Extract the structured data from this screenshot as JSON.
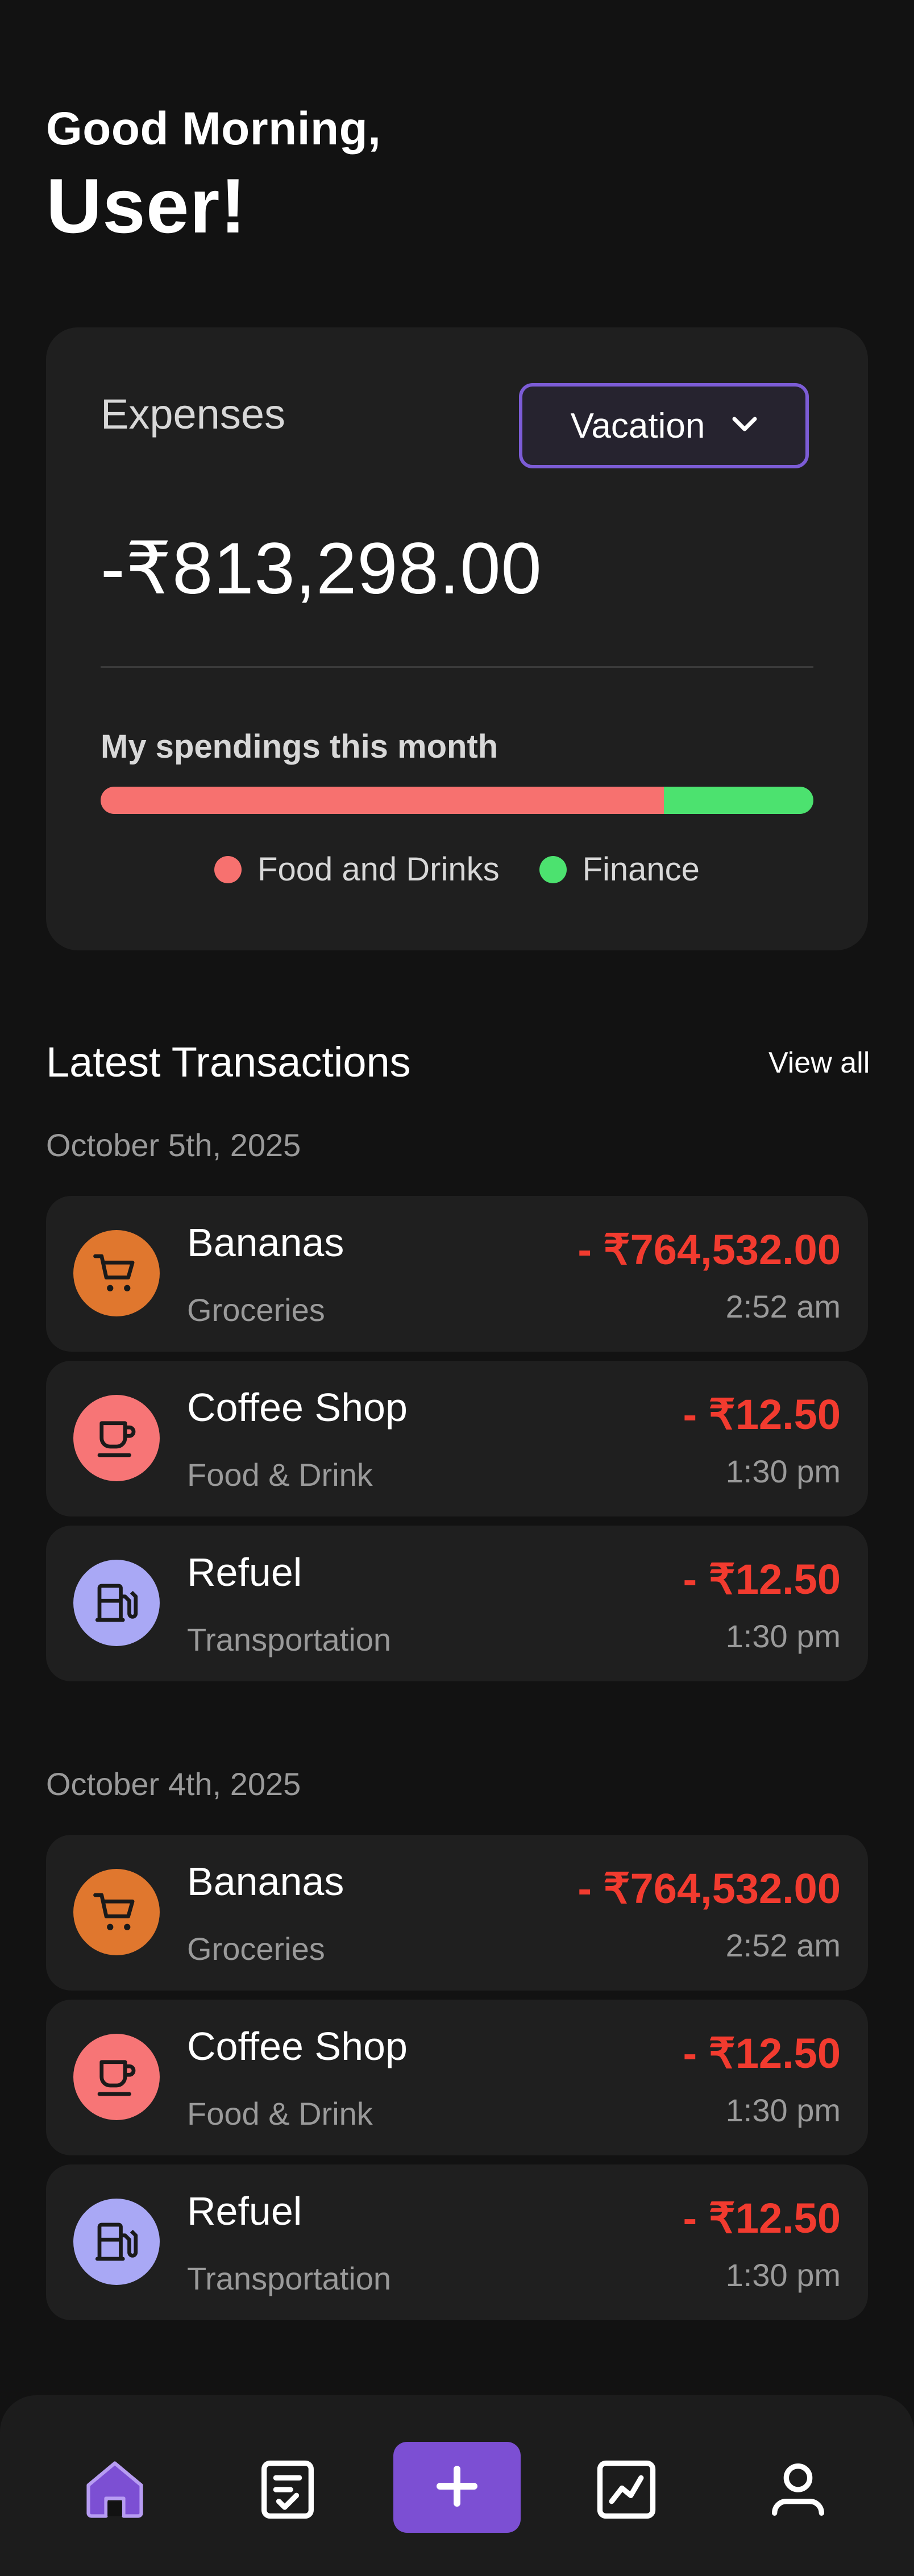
{
  "greeting": {
    "line1": "Good Morning,",
    "line2": "User!"
  },
  "expenses_card": {
    "label": "Expenses",
    "dropdown": {
      "selected": "Vacation",
      "icon": "chevron-down-icon"
    },
    "amount": "-₹813,298.00",
    "spendings_title": "My spendings this month",
    "spending_split": [
      {
        "category": "Food and Drinks",
        "fraction": 0.79,
        "color": "#f7716f"
      },
      {
        "category": "Finance",
        "fraction": 0.21,
        "color": "#4ce26f"
      }
    ],
    "legend": [
      {
        "label": "Food and Drinks",
        "color": "#f7716f"
      },
      {
        "label": "Finance",
        "color": "#4ce26f"
      }
    ]
  },
  "transactions": {
    "title": "Latest Transactions",
    "view_all": "View all",
    "groups": [
      {
        "date": "October 5th, 2025",
        "items": [
          {
            "name": "Bananas",
            "category": "Groceries",
            "amount": "- ₹764,532.00",
            "time": "2:52 am",
            "icon": "cart-icon",
            "icon_bg": "#e0772e"
          },
          {
            "name": "Coffee Shop",
            "category": "Food & Drink",
            "amount": "- ₹12.50",
            "time": "1:30 pm",
            "icon": "cup-icon",
            "icon_bg": "#f77576"
          },
          {
            "name": "Refuel",
            "category": "Transportation",
            "amount": "- ₹12.50",
            "time": "1:30 pm",
            "icon": "fuel-icon",
            "icon_bg": "#a9a8f5"
          }
        ]
      },
      {
        "date": "October 4th, 2025",
        "items": [
          {
            "name": "Bananas",
            "category": "Groceries",
            "amount": "- ₹764,532.00",
            "time": "2:52 am",
            "icon": "cart-icon",
            "icon_bg": "#e0772e"
          },
          {
            "name": "Coffee Shop",
            "category": "Food & Drink",
            "amount": "- ₹12.50",
            "time": "1:30 pm",
            "icon": "cup-icon",
            "icon_bg": "#f77576"
          },
          {
            "name": "Refuel",
            "category": "Transportation",
            "amount": "- ₹12.50",
            "time": "1:30 pm",
            "icon": "fuel-icon",
            "icon_bg": "#a9a8f5"
          }
        ]
      }
    ]
  },
  "bottom_nav": {
    "items": [
      {
        "icon": "home-icon",
        "active": true
      },
      {
        "icon": "checklist-icon",
        "active": false
      },
      {
        "icon": "plus-icon",
        "active": false
      },
      {
        "icon": "chart-icon",
        "active": false
      },
      {
        "icon": "profile-icon",
        "active": false
      }
    ]
  },
  "colors": {
    "background": "#121212",
    "card": "#1f1f1f",
    "accent": "#7c4fd3",
    "negative": "#f23b2f",
    "muted_text": "#9a9a9a"
  }
}
